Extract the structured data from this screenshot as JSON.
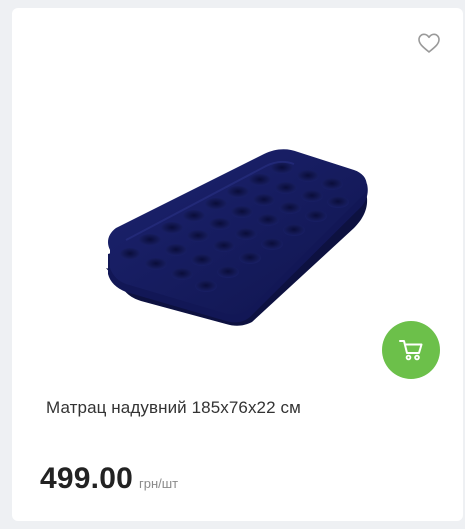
{
  "product": {
    "title": "Матрац надувний 185х76х22 см",
    "price": "499.00",
    "unit": "грн/шт",
    "image_icon": "inflatable-mattress-image"
  },
  "actions": {
    "wishlist_icon": "heart-icon",
    "cart_icon": "cart-icon"
  },
  "colors": {
    "accent": "#6cc04a",
    "mattress": "#14195a",
    "heart_stroke": "#9a9a9a"
  }
}
